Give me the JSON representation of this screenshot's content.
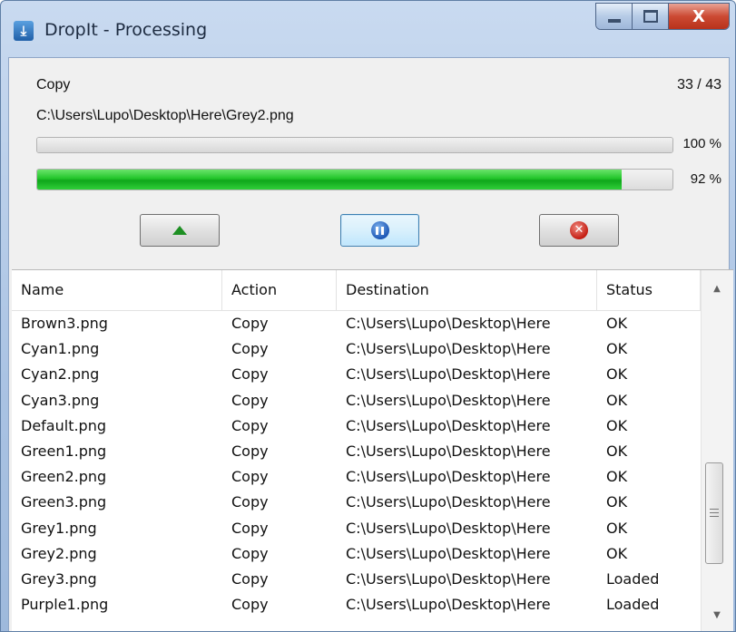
{
  "window": {
    "title": "DropIt - Processing",
    "icon": "dropit-app-icon",
    "controls": {
      "minimize": "minimize",
      "maximize": "maximize",
      "close": "X"
    }
  },
  "progress": {
    "action": "Copy",
    "count": "33 / 43",
    "file_path": "C:\\Users\\Lupo\\Desktop\\Here\\Grey2.png",
    "current_file_pct_label": "100 %",
    "current_file_fraction": 1.0,
    "overall_pct_label": "92 %",
    "overall_fraction": 0.92
  },
  "buttons": {
    "expand": {
      "icon": "triangle-up-icon"
    },
    "pause": {
      "icon": "pause-icon"
    },
    "stop": {
      "icon": "close-circle-icon"
    }
  },
  "table": {
    "columns": [
      "Name",
      "Action",
      "Destination",
      "Status"
    ],
    "rows": [
      [
        "Brown3.png",
        "Copy",
        "C:\\Users\\Lupo\\Desktop\\Here",
        "OK"
      ],
      [
        "Cyan1.png",
        "Copy",
        "C:\\Users\\Lupo\\Desktop\\Here",
        "OK"
      ],
      [
        "Cyan2.png",
        "Copy",
        "C:\\Users\\Lupo\\Desktop\\Here",
        "OK"
      ],
      [
        "Cyan3.png",
        "Copy",
        "C:\\Users\\Lupo\\Desktop\\Here",
        "OK"
      ],
      [
        "Default.png",
        "Copy",
        "C:\\Users\\Lupo\\Desktop\\Here",
        "OK"
      ],
      [
        "Green1.png",
        "Copy",
        "C:\\Users\\Lupo\\Desktop\\Here",
        "OK"
      ],
      [
        "Green2.png",
        "Copy",
        "C:\\Users\\Lupo\\Desktop\\Here",
        "OK"
      ],
      [
        "Green3.png",
        "Copy",
        "C:\\Users\\Lupo\\Desktop\\Here",
        "OK"
      ],
      [
        "Grey1.png",
        "Copy",
        "C:\\Users\\Lupo\\Desktop\\Here",
        "OK"
      ],
      [
        "Grey2.png",
        "Copy",
        "C:\\Users\\Lupo\\Desktop\\Here",
        "OK"
      ],
      [
        "Grey3.png",
        "Copy",
        "C:\\Users\\Lupo\\Desktop\\Here",
        "Loaded"
      ],
      [
        "Purple1.png",
        "Copy",
        "C:\\Users\\Lupo\\Desktop\\Here",
        "Loaded"
      ]
    ]
  },
  "colors": {
    "progress_green": "#22c52a",
    "titlebar": "#aac3e3",
    "close_button": "#cc4a33"
  }
}
